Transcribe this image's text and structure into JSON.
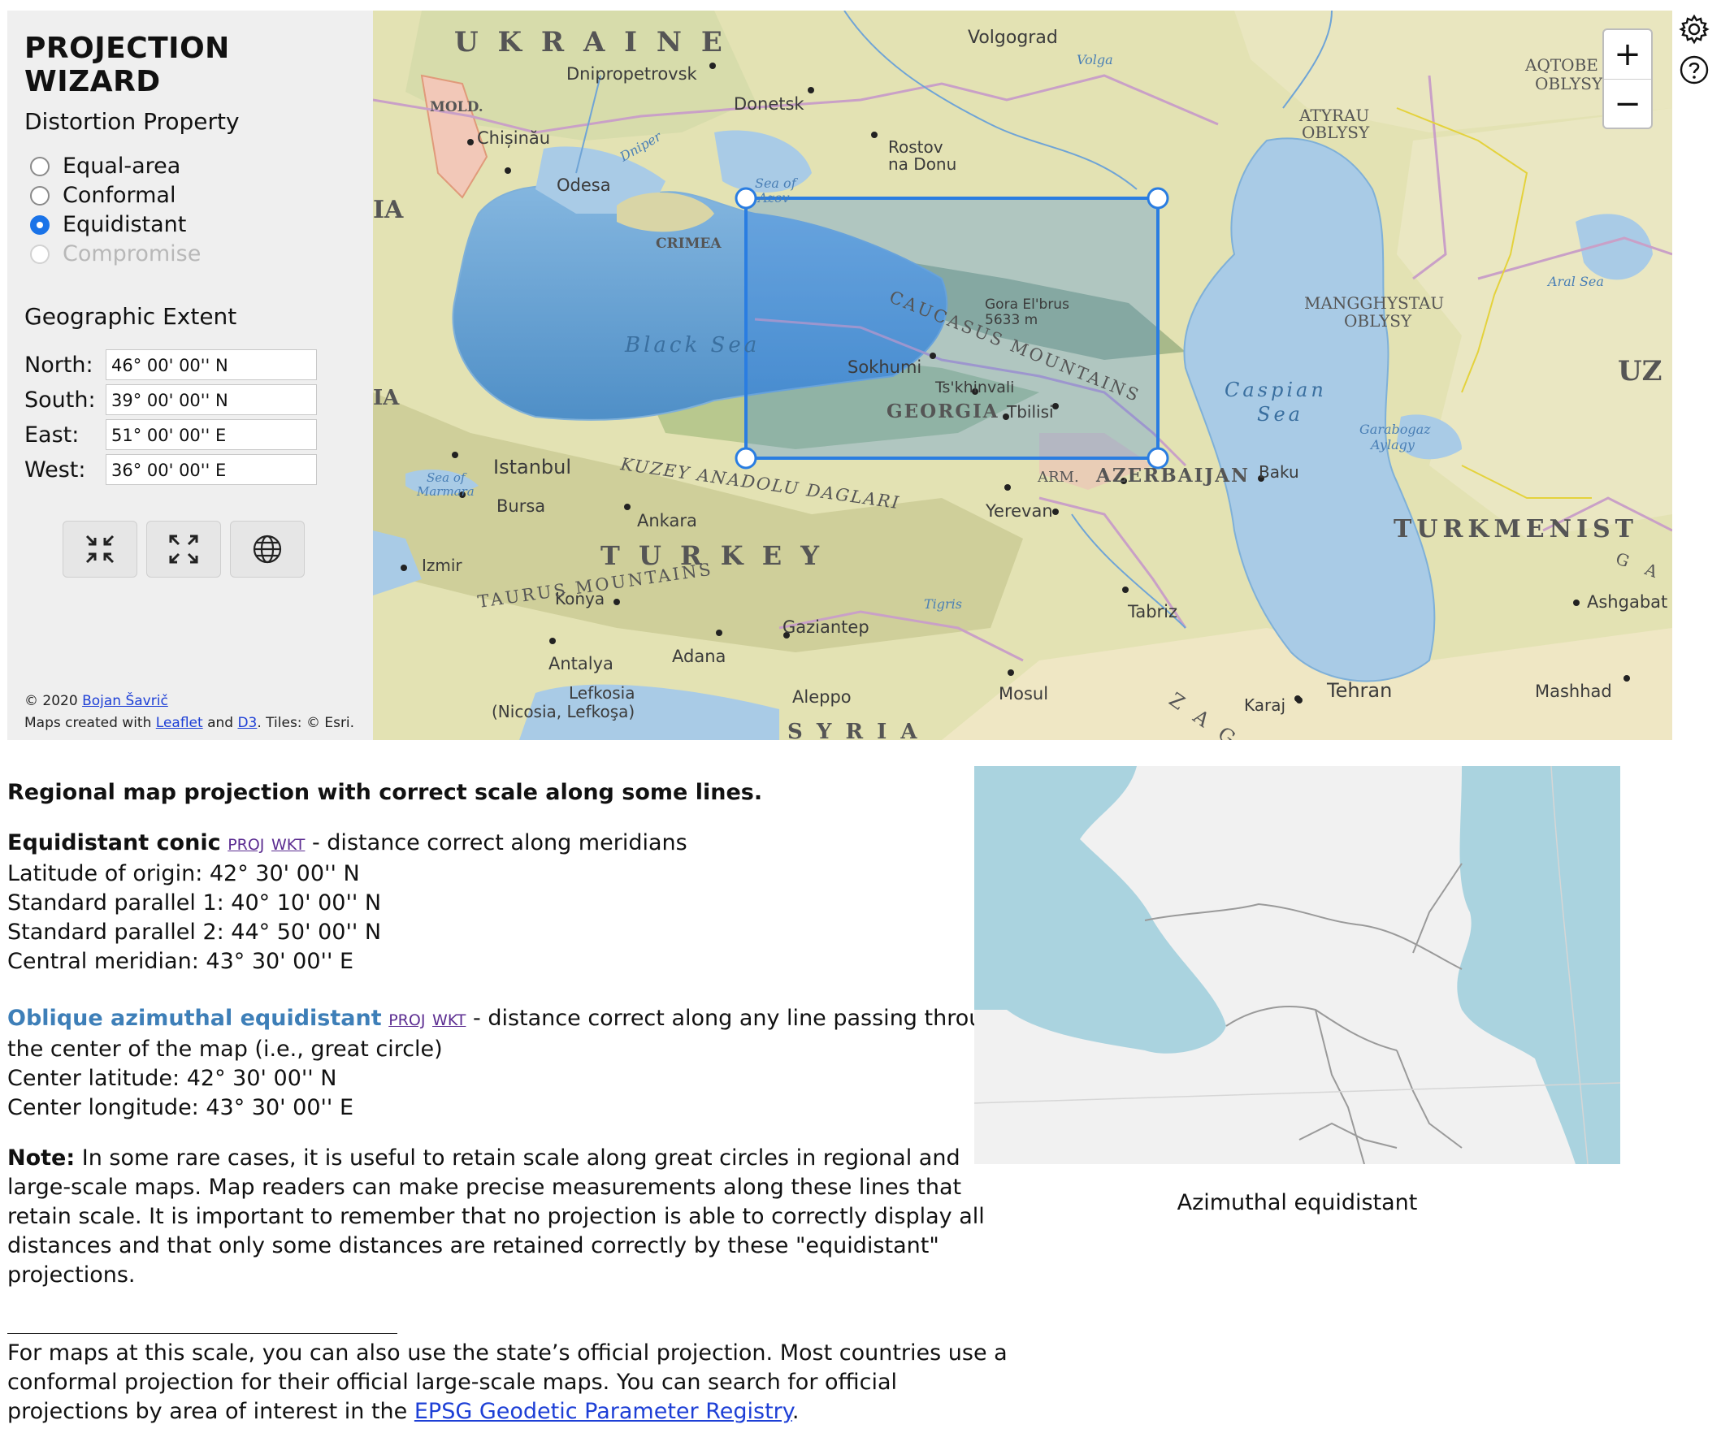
{
  "sidebar": {
    "title": "PROJECTION WIZARD",
    "distortion_title": "Distortion Property",
    "options": [
      {
        "label": "Equal-area",
        "checked": false,
        "disabled": false
      },
      {
        "label": "Conformal",
        "checked": false,
        "disabled": false
      },
      {
        "label": "Equidistant",
        "checked": true,
        "disabled": false
      },
      {
        "label": "Compromise",
        "checked": false,
        "disabled": true
      }
    ],
    "extent_title": "Geographic Extent",
    "extent": [
      {
        "label": "North:",
        "value": "46° 00' 00'' N"
      },
      {
        "label": "South:",
        "value": "39° 00' 00'' N"
      },
      {
        "label": "East:",
        "value": "51° 00' 00'' E"
      },
      {
        "label": "West:",
        "value": "36° 00' 00'' E"
      }
    ],
    "buttons": [
      {
        "icon": "shrink-arrows-icon"
      },
      {
        "icon": "expand-arrows-icon"
      },
      {
        "icon": "globe-icon"
      }
    ],
    "credit_line1_prefix": "© 2020",
    "credit_author": "Bojan Šavrič",
    "credit_line2_prefix": "Maps created with",
    "credit_leaflet": "Leaflet",
    "credit_and": "and",
    "credit_d3": "D3",
    "credit_tiles": ". Tiles: © Esri."
  },
  "map": {
    "labels": {
      "ukraine": "U K R A I N E",
      "volgograd": "Volgograd",
      "volga": "Volga",
      "dnipro": "Dnipropetrovsk",
      "donetsk": "Donetsk",
      "mold": "MOLD.",
      "chisinau": "Chișinău",
      "dniper": "Dniper",
      "rostov1": "Rostov",
      "rostov2": "na Donu",
      "odesa": "Odesa",
      "seaofazov1": "Sea of",
      "seaofazov2": "Azov",
      "crimea": "CRIMEA",
      "ia1": "IA",
      "ia2": "IA",
      "blacksea": "Black Sea",
      "gora1": "Gora El'brus",
      "gora2": "5633 m",
      "caucasus": "CAUCASUS MOUNTAINS",
      "sokhumi": "Sokhumi",
      "tskhinvali": "Ts'khinvali",
      "georgia": "GEORGIA",
      "tbilisi": "Tbilisi",
      "caspian1": "Caspian",
      "caspian2": "Sea",
      "istanbul": "Istanbul",
      "marmara1": "Sea of",
      "marmara2": "Marmara",
      "bursa": "Bursa",
      "kuzey": "KUZEY ANADOLU DAGLARI",
      "ankara": "Ankara",
      "arm": "ARM.",
      "azerbaijan": "AZERBAIJAN",
      "baku": "Baku",
      "yerevan": "Yerevan",
      "turkey": "T U R K E Y",
      "izmir": "Izmir",
      "konya": "Konya",
      "taurus": "TAURUS MOUNTAINS",
      "antalya": "Antalya",
      "adana": "Adana",
      "gaziantep": "Gaziantep",
      "tigris": "Tigris",
      "tabriz": "Tabriz",
      "lefkosia1": "Lefkosia",
      "lefkosia2": "(Nicosia, Lefkoşa)",
      "aleppo": "Aleppo",
      "syria": "S Y R I A",
      "mosul": "Mosul",
      "zag": "Z A G",
      "karaj": "Karaj",
      "tehran": "Tehran",
      "mashhad": "Mashhad",
      "ashgabat": "Ashgabat",
      "turkmenist": "TURKMENIST",
      "ga": "G A",
      "mangghystau1": "MANGGHYSTAU",
      "mangghystau2": "OBLYSY",
      "atyrau1": "ATYRAU",
      "atyrau2": "OBLYSY",
      "aqtobe1": "AQTOBE",
      "aqtobe2": "OBLYSY",
      "aralsea": "Aral Sea",
      "garabogaz1": "Garabogaz",
      "garabogaz2": "Aylagy",
      "uz": "UZ"
    },
    "zoom_in": "+",
    "zoom_out": "−",
    "colors": {
      "water": "#a9cbe6",
      "deep_water": "#5f9ccf",
      "land": "#e3e2b3",
      "selection": "#2a7de1"
    }
  },
  "side_icons": [
    "gear-icon",
    "help-icon"
  ],
  "content": {
    "heading": "Regional map projection with correct scale along some lines.",
    "eq_conic_title": "Equidistant conic",
    "proj_link": "PROJ",
    "wkt_link": "WKT",
    "eq_conic_desc": " - distance correct along meridians",
    "eq_conic_params": [
      "Latitude of origin: 42° 30' 00'' N",
      "Standard parallel 1: 40° 10' 00'' N",
      "Standard parallel 2: 44° 50' 00'' N",
      "Central meridian: 43° 30' 00'' E"
    ],
    "oblique_title": "Oblique azimuthal equidistant",
    "oblique_desc_1": " - distance correct along any line passing through",
    "oblique_desc_2": "the center of the map (i.e., great circle)",
    "oblique_params": [
      "Center latitude: 42° 30' 00'' N",
      "Center longitude: 43° 30' 00'' E"
    ],
    "note_label": "Note:",
    "note_lines": [
      " In some rare cases, it is useful to retain scale along great circles in regional and",
      "large-scale maps. Map readers can make precise measurements along these lines that",
      "retain scale. It is important to remember that no projection is able to correctly display all",
      "distances and that only some distances are retained correctly by these \"equidistant\"",
      "projections."
    ],
    "footer_lines": [
      "For maps at this scale, you can also use the state’s official projection. Most countries use a",
      "conformal projection for their official large-scale maps. You can search for official"
    ],
    "footer_line3_prefix": "projections by area of interest in the ",
    "footer_link": "EPSG Geodetic Parameter Registry",
    "footer_line3_suffix": ".",
    "preview_caption": "Azimuthal equidistant"
  }
}
